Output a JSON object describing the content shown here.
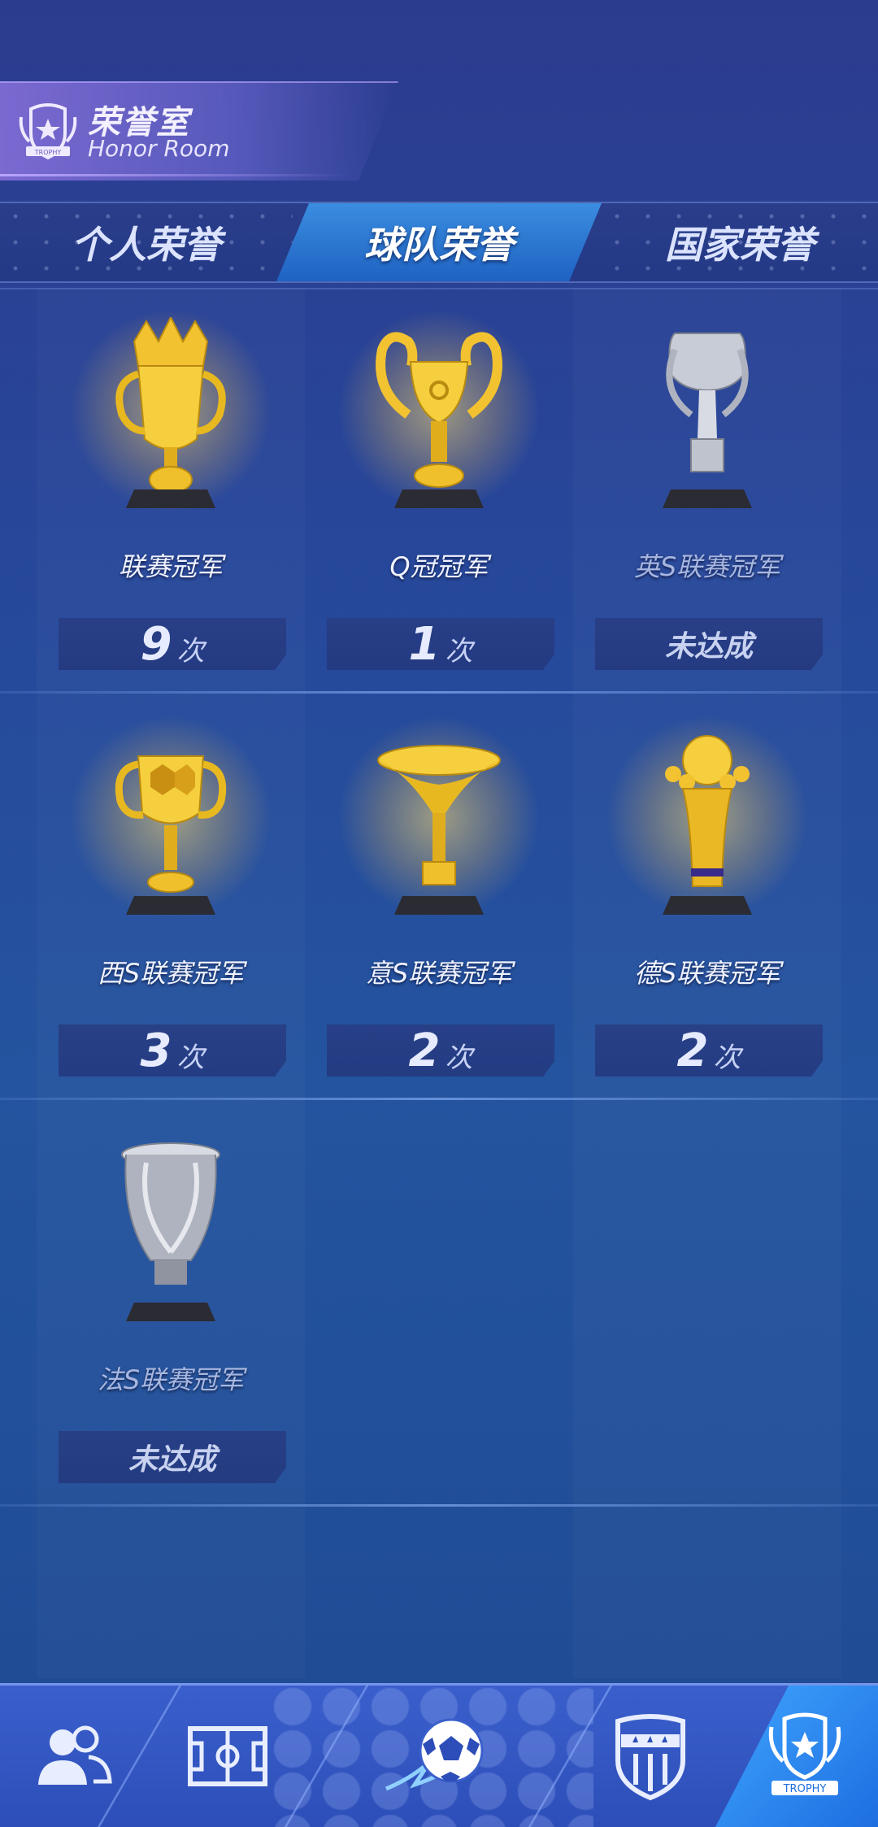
{
  "header": {
    "title": "荣誉室",
    "subtitle": "Honor Room",
    "emblem_text": "TROPHY"
  },
  "tabs": [
    {
      "label": "个人荣誉",
      "active": false
    },
    {
      "label": "球队荣誉",
      "active": true
    },
    {
      "label": "国家荣誉",
      "active": false
    }
  ],
  "trophies": [
    {
      "name": "联赛冠军",
      "count": "9",
      "unit": "次",
      "status": "",
      "achieved": true
    },
    {
      "name": "Q冠冠军",
      "count": "1",
      "unit": "次",
      "status": "",
      "achieved": true
    },
    {
      "name": "英S联赛冠军",
      "count": "",
      "unit": "",
      "status": "未达成",
      "achieved": false
    },
    {
      "name": "西S联赛冠军",
      "count": "3",
      "unit": "次",
      "status": "",
      "achieved": true
    },
    {
      "name": "意S联赛冠军",
      "count": "2",
      "unit": "次",
      "status": "",
      "achieved": true
    },
    {
      "name": "德S联赛冠军",
      "count": "2",
      "unit": "次",
      "status": "",
      "achieved": true
    },
    {
      "name": "法S联赛冠军",
      "count": "",
      "unit": "",
      "status": "未达成",
      "achieved": false
    }
  ],
  "nav": [
    {
      "icon": "team-icon"
    },
    {
      "icon": "pitch-icon"
    },
    {
      "icon": "soccer-ball-icon"
    },
    {
      "icon": "club-badge-icon"
    },
    {
      "icon": "trophy-icon",
      "active": true,
      "label": "TROPHY"
    }
  ],
  "colors": {
    "gold": "#f2c230",
    "silver": "#c8ccd6",
    "accent_tab": "#2a7ad6"
  }
}
